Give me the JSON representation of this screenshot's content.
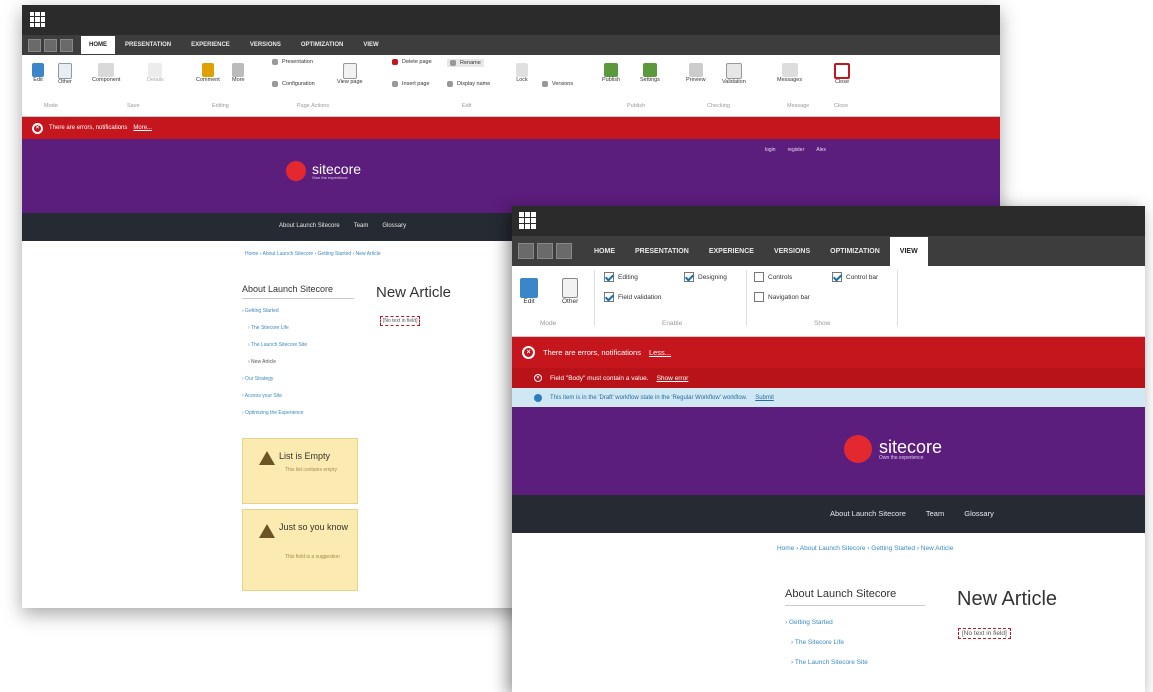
{
  "back": {
    "tabs": [
      "HOME",
      "PRESENTATION",
      "EXPERIENCE",
      "VERSIONS",
      "OPTIMIZATION",
      "VIEW"
    ],
    "ribbon": {
      "edit": "Edit",
      "other": "Other",
      "component": "Component",
      "details": "Details",
      "comment": "Comment",
      "more": "More",
      "presentation": "Presentation",
      "configuration": "Configuration",
      "view_page": "View page",
      "delete_page": "Delete page",
      "insert_page": "Insert page",
      "rename": "Rename",
      "display_name": "Display name",
      "lock": "Lock",
      "versions": "Versions",
      "publish": "Publish",
      "settings": "Settings",
      "preview": "Preview",
      "validation": "Validation",
      "messages": "Messages",
      "close": "Close",
      "groups": [
        "Mode",
        "Save",
        "Editing",
        "Page Actions",
        "Edit",
        "Publish",
        "Checking",
        "Message",
        "Close"
      ]
    },
    "notification": "There are errors, notifications",
    "notification_more": "More...",
    "header_links": [
      "login",
      "register",
      "Alex"
    ],
    "brand": "sitecore",
    "tagline": "Own the experience",
    "nav": [
      "About Launch Sitecore",
      "Team",
      "Glossary"
    ],
    "breadcrumb": "Home › About Launch Sitecore › Getting Started › New Article",
    "sidebar_title": "About Launch Sitecore",
    "sidebar_links": [
      "› Getting Started",
      "› The Sitecore Life",
      "› The Launch Sitecore Site",
      "› New Article",
      "› Our Strategy",
      "› Access your Site",
      "› Optimizing the Experience"
    ],
    "article_title": "New Article",
    "field_placeholder": "[No text in field]",
    "warnings": [
      {
        "title": "List is Empty",
        "sub": "This list contains empty"
      },
      {
        "title": "Just so you know",
        "sub": "This field is a suggestion"
      }
    ]
  },
  "front": {
    "tabs": [
      "HOME",
      "PRESENTATION",
      "EXPERIENCE",
      "VERSIONS",
      "OPTIMIZATION",
      "VIEW"
    ],
    "ribbon": {
      "edit": "Edit",
      "other": "Other",
      "editing": "Editing",
      "designing": "Designing",
      "field_validation": "Field validation",
      "controls": "Controls",
      "control_bar": "Control bar",
      "navigation_bar": "Navigation bar",
      "groups": [
        "Mode",
        "Enable",
        "Show"
      ]
    },
    "notification": "There are errors, notifications",
    "notification_more": "Less...",
    "error": "Field \"Body\" must contain a value.",
    "error_link": "Show error",
    "info": "This item is in the 'Draft' workflow state in the 'Regular Workflow' workflow.",
    "info_link": "Submit",
    "brand": "sitecore",
    "tagline": "Own the experience",
    "nav": [
      "About Launch Sitecore",
      "Team",
      "Glossary"
    ],
    "breadcrumb": "Home › About Launch Sitecore › Getting Started › New Article",
    "sidebar_title": "About Launch Sitecore",
    "sidebar_links": [
      "› Getting Started",
      "› The Sitecore Life",
      "› The Launch Sitecore Site"
    ],
    "article_title": "New Article",
    "field_placeholder": "[No text in field]"
  }
}
